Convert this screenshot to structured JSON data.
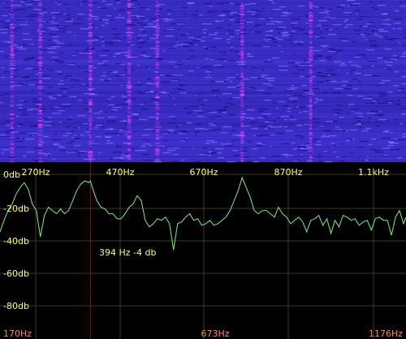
{
  "waterfall": {
    "bg_color": "#2a1fa6",
    "line_color": "#5a48ff",
    "hot_color": "#ff40ff"
  },
  "spectrum": {
    "bg_color": "#000000",
    "grid_color": "#3a3a2a",
    "trace_color": "#7cf07c",
    "cursor_color": "#8a1010",
    "label_color": "#ffff66",
    "edge_label_color": "#ff8a3a",
    "top_ticks": [
      "270Hz",
      "470Hz",
      "670Hz",
      "870Hz",
      "1.1kHz"
    ],
    "db_ticks": [
      "0db",
      "-20db",
      "-40db",
      "-60db",
      "-80db"
    ],
    "bottom_ticks": [
      "170Hz",
      "673Hz",
      "1176Hz"
    ],
    "readout": "394 Hz  -4 db"
  },
  "chart_data": {
    "type": "line",
    "title": "",
    "xlabel": "",
    "ylabel": "",
    "xlim": [
      170,
      1176
    ],
    "ylim": [
      -100,
      0
    ],
    "series": [
      {
        "x": [
          170,
          180,
          190,
          200,
          210,
          220,
          230,
          240,
          250,
          260,
          270,
          280,
          290,
          300,
          310,
          320,
          330,
          340,
          350,
          360,
          370,
          380,
          390,
          394,
          400,
          410,
          420,
          430,
          440,
          450,
          460,
          470,
          480,
          490,
          500,
          510,
          520,
          530,
          540,
          550,
          560,
          570,
          580,
          590,
          600,
          610,
          620,
          630,
          640,
          650,
          660,
          670,
          680,
          690,
          700,
          710,
          720,
          730,
          740,
          750,
          760,
          770,
          780,
          790,
          800,
          810,
          820,
          830,
          840,
          850,
          860,
          870,
          880,
          890,
          900,
          910,
          920,
          930,
          940,
          950,
          960,
          970,
          980,
          990,
          1000,
          1010,
          1020,
          1030,
          1040,
          1050,
          1060,
          1070,
          1080,
          1090,
          1100,
          1110,
          1120,
          1130,
          1140,
          1150,
          1160,
          1170,
          1176
        ],
        "y": [
          -35,
          -28,
          -22,
          -18,
          -12,
          -8,
          -5,
          -9,
          -18,
          -22,
          -38,
          -25,
          -20,
          -22,
          -24,
          -21,
          -24,
          -22,
          -16,
          -10,
          -6,
          -4,
          -5,
          -4,
          -9,
          -16,
          -20,
          -21,
          -24,
          -24,
          -27,
          -27,
          -24,
          -20,
          -18,
          -13,
          -16,
          -28,
          -32,
          -30,
          -27,
          -28,
          -26,
          -30,
          -46,
          -30,
          -29,
          -26,
          -24,
          -28,
          -27,
          -31,
          -30,
          -28,
          -31,
          -30,
          -28,
          -26,
          -22,
          -16,
          -10,
          -2,
          -8,
          -14,
          -22,
          -24,
          -22,
          -22,
          -24,
          -26,
          -20,
          -24,
          -26,
          -30,
          -28,
          -26,
          -29,
          -35,
          -28,
          -27,
          -25,
          -31,
          -27,
          -36,
          -28,
          -32,
          -25,
          -26,
          -28,
          -27,
          -31,
          -29,
          -28,
          -34,
          -27,
          -26,
          -28,
          -28,
          -37,
          -26,
          -22,
          -30,
          -26
        ]
      }
    ],
    "cursor_x": 394
  }
}
